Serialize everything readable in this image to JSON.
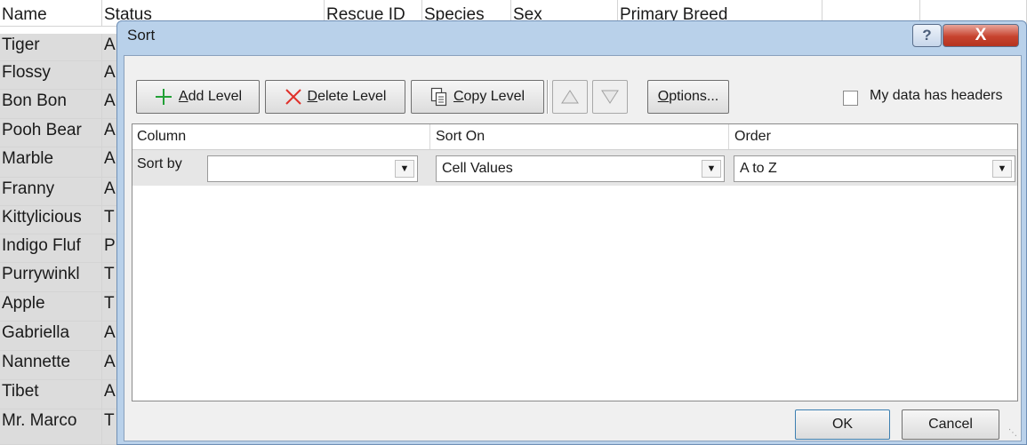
{
  "sheet": {
    "headers": [
      "Name",
      "Status",
      "Rescue ID",
      "Species",
      "Sex",
      "Primary Breed"
    ],
    "rows": [
      {
        "name": "Tiger",
        "status": "A"
      },
      {
        "name": "Flossy",
        "status": "A"
      },
      {
        "name": "Bon Bon",
        "status": "A"
      },
      {
        "name": "Pooh Bear",
        "status": "A"
      },
      {
        "name": "Marble",
        "status": "A"
      },
      {
        "name": "Franny",
        "status": "A"
      },
      {
        "name": "Kittylicious",
        "status": "T"
      },
      {
        "name": "Indigo Fluf",
        "status": "P"
      },
      {
        "name": "Purrywinkl",
        "status": "T"
      },
      {
        "name": "Apple",
        "status": "T"
      },
      {
        "name": "Gabriella",
        "status": "A"
      },
      {
        "name": "Nannette",
        "status": "A"
      },
      {
        "name": "Tibet",
        "status": "A"
      },
      {
        "name": "Mr. Marco",
        "status": "T"
      }
    ]
  },
  "dialog": {
    "title": "Sort",
    "help": "?",
    "close": "X",
    "toolbar": {
      "add_level": {
        "pre": "",
        "key": "A",
        "post": "dd Level"
      },
      "delete_level": {
        "pre": "",
        "key": "D",
        "post": "elete Level"
      },
      "copy_level": {
        "pre": "",
        "key": "C",
        "post": "opy Level"
      },
      "options": {
        "pre": "",
        "key": "O",
        "post": "ptions..."
      }
    },
    "headers_checkbox": {
      "pre": "My data has ",
      "key": "h",
      "post": "eaders",
      "checked": false
    },
    "columns": {
      "column": "Column",
      "sort_on": "Sort On",
      "order": "Order"
    },
    "level": {
      "label": "Sort by",
      "column_value": "",
      "sort_on_value": "Cell Values",
      "order_value": "A to Z"
    },
    "buttons": {
      "ok": "OK",
      "cancel": "Cancel"
    }
  },
  "colors": {
    "add_icon": "#22a036",
    "delete_icon": "#e0302a",
    "dialog_frame": "#b9d1ea",
    "close_button": "#c7432f"
  },
  "icons": [
    "plus-icon",
    "x-icon",
    "copy-icon",
    "triangle-up-icon",
    "triangle-down-icon",
    "chevron-down-icon",
    "help-icon",
    "close-icon"
  ]
}
